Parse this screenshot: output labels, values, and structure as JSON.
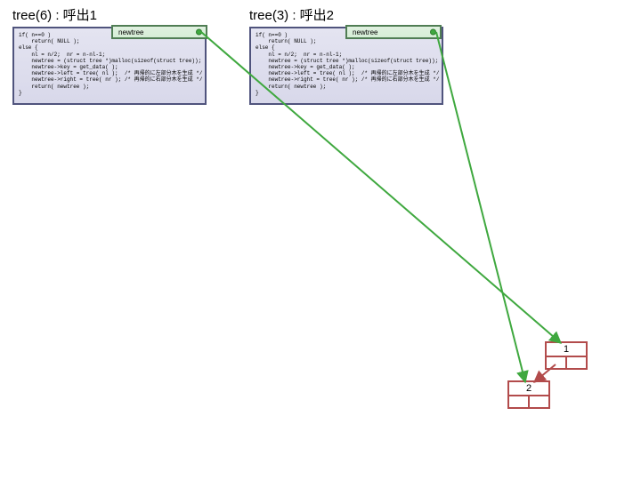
{
  "titles": {
    "left": "tree(6) : 呼出1",
    "right": "tree(3) : 呼出2"
  },
  "code_block": "if( n==0 )\n    return( NULL );\nelse {\n    nl = n/2;  nr = n-nl-1;\n    newtree = (struct tree *)malloc(sizeof(struct tree));\n    newtree->key = get_data( );\n    newtree->left = tree( nl );  /* 再帰的に左部分木を生成 */\n    newtree->right = tree( nr ); /* 再帰的に右部分木を生成 */\n    return( newtree );\n}",
  "newtree_label": "newtree",
  "nodes": {
    "node1": "1",
    "node2": "2"
  }
}
